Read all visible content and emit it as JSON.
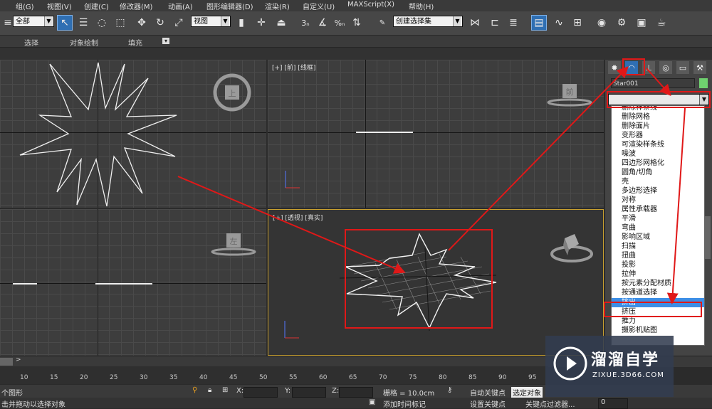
{
  "menu": [
    "组(G)",
    "视图(V)",
    "创建(C)",
    "修改器(M)",
    "动画(A)",
    "图形编辑器(D)",
    "渲染(R)",
    "自定义(U)",
    "MAXScript(X)",
    "帮助(H)"
  ],
  "toolbar": {
    "selection_filter": "全部",
    "ref_coord": "视图",
    "named_selection": "创建选择集"
  },
  "ribbon": [
    "选择",
    "对象绘制",
    "填充"
  ],
  "viewports": {
    "front": {
      "label": "[+] [前] [线框]",
      "cube_label": "前"
    },
    "top": {
      "cube_label": "上"
    },
    "left": {
      "cube_label": "左"
    },
    "perspective": {
      "label": "[+] [透视] [真实]",
      "cube_label": ""
    }
  },
  "command_panel": {
    "object_name": "Star001",
    "modifier_list_value": "",
    "modifier_items": [
      "删除样条线",
      "删除网格",
      "删除面片",
      "变形器",
      "可渲染样条线",
      "噪波",
      "四边形网格化",
      "圆角/切角",
      "壳",
      "多边形选择",
      "对称",
      "属性承载器",
      "平滑",
      "弯曲",
      "影响区域",
      "扫描",
      "扭曲",
      "投影",
      "拉伸",
      "按元素分配材质",
      "按通道选择",
      "挤出",
      "挤压",
      "推力",
      "摄影机贴图"
    ],
    "highlighted_item": "挤出"
  },
  "timeline": {
    "ticks": [
      "10",
      "15",
      "20",
      "25",
      "30",
      "35",
      "40",
      "45",
      "50",
      "55",
      "60",
      "65",
      "70",
      "75",
      "80",
      "85",
      "90",
      "95"
    ]
  },
  "status": {
    "selection_info": "个图形",
    "prompt": "击并拖动以选择对象",
    "x_label": "X:",
    "y_label": "Y:",
    "z_label": "Z:",
    "grid": "栅格 = 10.0cm",
    "add_time_tag": "添加时间标记",
    "auto_key": "自动关键点",
    "set_key": "设置关键点",
    "selected_object": "选定对象",
    "key_filter": "关键点过滤器...",
    "frame": "0"
  },
  "watermark": {
    "title": "溜溜自学",
    "url": "ZIXUE.3D66.COM"
  },
  "colors": {
    "highlight": "#3c8ee6",
    "annotation": "#e01818",
    "object_color": "#6fd16f"
  }
}
